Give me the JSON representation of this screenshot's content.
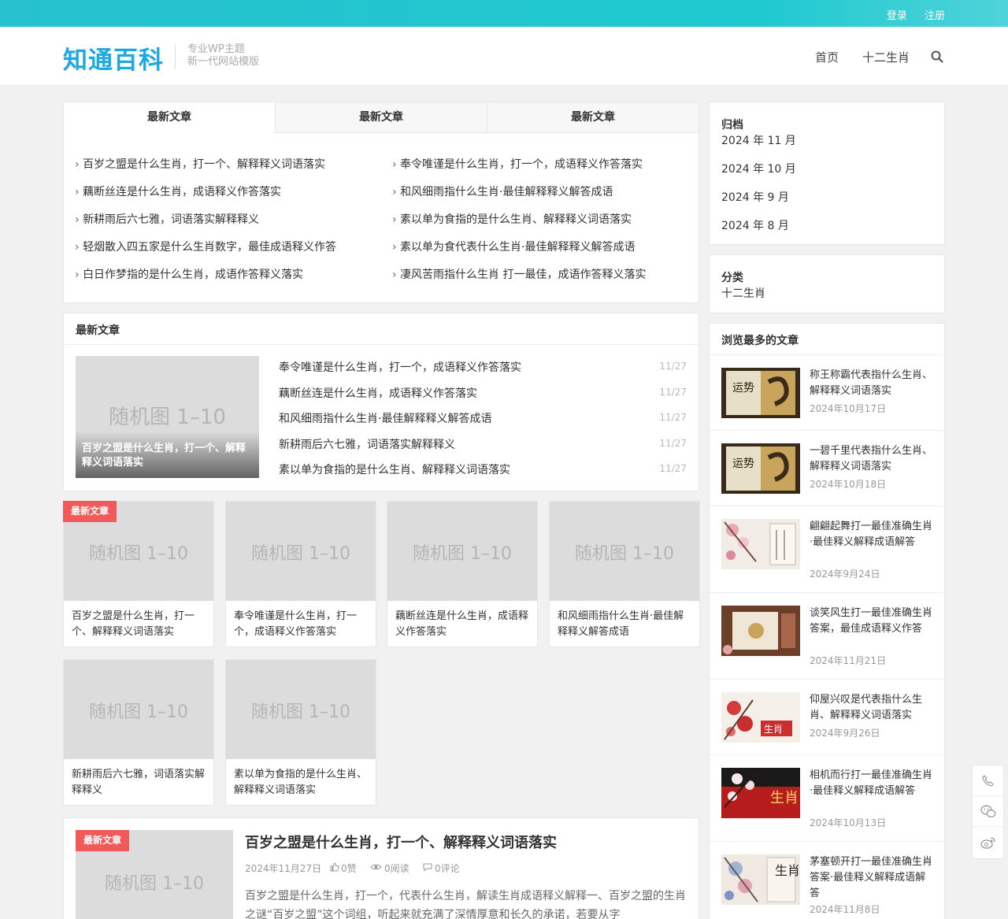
{
  "topbar": {
    "login": "登录",
    "register": "注册"
  },
  "header": {
    "logo": "知通百科",
    "tagline_line1": "专业WP主题",
    "tagline_line2": "新一代网站模版",
    "nav": [
      "首页",
      "十二生肖"
    ]
  },
  "tabs_box": {
    "tabs": [
      "最新文章",
      "最新文章",
      "最新文章"
    ],
    "left_links": [
      "百岁之盟是什么生肖，打一个、解释释义词语落实",
      "藕断丝连是什么生肖，成语释义作答落实",
      "新耕雨后六七雅，词语落实解释释义",
      "轻烟散入四五家是什么生肖数字，最佳成语释义作答",
      "白日作梦指的是什么生肖，成语作答释义落实"
    ],
    "right_links": [
      "奉令唯谨是什么生肖，打一个，成语释义作答落实",
      "和风细雨指什么生肖·最佳解释释义解答成语",
      "素以单为食指的是什么生肖、解释释义词语落实",
      "素以单为食代表什么生肖·最佳解释释义解答成语",
      "凄风苦雨指什么生肖 打一最佳，成语作答释义落实"
    ]
  },
  "latest_box": {
    "title": "最新文章",
    "featured_placeholder": "随机图 1–10",
    "featured_caption": "百岁之盟是什么生肖，打一个、解释释义词语落实",
    "items": [
      {
        "title": "奉令唯谨是什么生肖，打一个，成语释义作答落实",
        "date": "11/27"
      },
      {
        "title": "藕断丝连是什么生肖，成语释义作答落实",
        "date": "11/27"
      },
      {
        "title": "和风细雨指什么生肖·最佳解释释义解答成语",
        "date": "11/27"
      },
      {
        "title": "新耕雨后六七雅，词语落实解释释义",
        "date": "11/27"
      },
      {
        "title": "素以单为食指的是什么生肖、解释释义词语落实",
        "date": "11/27"
      }
    ]
  },
  "grid": {
    "badge": "最新文章",
    "placeholder": "随机图 1–10",
    "cards": [
      "百岁之盟是什么生肖，打一个、解释释义词语落实",
      "奉令唯谨是什么生肖，打一个，成语释义作答落实",
      "藕断丝连是什么生肖，成语释义作答落实",
      "和风细雨指什么生肖·最佳解释释义解答成语",
      "新耕雨后六七雅，词语落实解释释义",
      "素以单为食指的是什么生肖、解释释义词语落实"
    ]
  },
  "article": {
    "badge": "最新文章",
    "placeholder": "随机图 1–10",
    "title": "百岁之盟是什么生肖，打一个、解释释义词语落实",
    "date": "2024年11月27日",
    "likes": "0赞",
    "reads": "0阅读",
    "comments": "0评论",
    "excerpt": "百岁之盟是什么生肖，打一个，代表什么生肖，解读生肖成语释义解释一、百岁之盟的生肖之谜“百岁之盟”这个词组，听起来就充满了深情厚意和长久的承诺，若要从字"
  },
  "sidebar": {
    "archive_title": "归档",
    "archive": [
      "2024 年 11 月",
      "2024 年 10 月",
      "2024 年 9 月",
      "2024 年 8 月"
    ],
    "category_title": "分类",
    "categories": [
      "十二生肖"
    ],
    "popular_title": "浏览最多的文章",
    "popular": [
      {
        "title": "称王称霸代表指什么生肖、解释释义词语落实",
        "date": "2024年10月17日",
        "thumb_text": "运势",
        "thumb": "scroll"
      },
      {
        "title": "一碧千里代表指什么生肖、解释释义词语落实",
        "date": "2024年10月18日",
        "thumb_text": "运势",
        "thumb": "scroll"
      },
      {
        "title": "翩翩起舞打一最佳准确生肖·最佳释义解释成语解答",
        "date": "2024年9月24日",
        "thumb_text": "",
        "thumb": "blossom"
      },
      {
        "title": "谈笑风生打一最佳准确生肖答案，最佳成语释义作答",
        "date": "2024年11月21日",
        "thumb_text": "",
        "thumb": "brown"
      },
      {
        "title": "仰屋兴叹是代表指什么生肖、解释释义词语落实",
        "date": "2024年9月26日",
        "thumb_text": "生肖",
        "thumb": "flower"
      },
      {
        "title": "相机而行打一最佳准确生肖·最佳释义解释成语解答",
        "date": "2024年10月13日",
        "thumb_text": "生肖",
        "thumb": "red"
      },
      {
        "title": "茅塞顿开打一最佳准确生肖答案·最佳释义解释成语解答",
        "date": "2024年11月8日",
        "thumb_text": "生肖",
        "thumb": "crane"
      }
    ]
  },
  "colors": {
    "brand": "#1ca8e3",
    "topbar": "#1ec9cf",
    "badge": "#f05a5a"
  }
}
